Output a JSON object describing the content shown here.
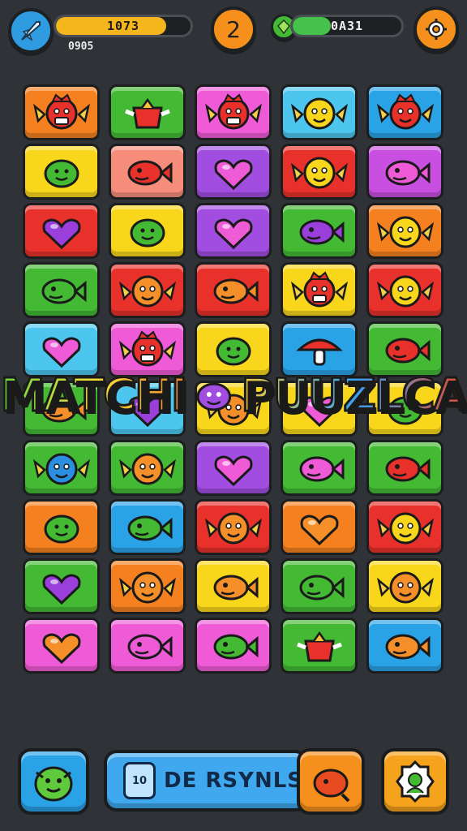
{
  "hud": {
    "xp_bar_value": "1073",
    "xp_progress": 0.82,
    "xp_subtext": "0905",
    "level_number": "2",
    "energy_bar_value": "0A31",
    "energy_progress": 0.35
  },
  "title": {
    "word1": "MATCHI",
    "word2": "PUUZLCA"
  },
  "board": {
    "rows": [
      [
        {
          "color": "orange",
          "icon": "red-dragon-icon"
        },
        {
          "color": "green",
          "icon": "red-pot-icon"
        },
        {
          "color": "pink",
          "icon": "red-dragon-icon"
        },
        {
          "color": "cyan",
          "icon": "yellow-bird-icon"
        },
        {
          "color": "blue",
          "icon": "red-crown-bird-icon"
        }
      ],
      [
        {
          "color": "yellow",
          "icon": "green-blob-icon"
        },
        {
          "color": "salmon",
          "icon": "red-fish-icon"
        },
        {
          "color": "purple",
          "icon": "pink-heart-icon"
        },
        {
          "color": "red",
          "icon": "yellow-bird-icon"
        },
        {
          "color": "violet",
          "icon": "pink-fish-icon"
        }
      ],
      [
        {
          "color": "red",
          "icon": "purple-heart-icon"
        },
        {
          "color": "yellow",
          "icon": "green-blob-icon"
        },
        {
          "color": "purple",
          "icon": "pink-heart-icon"
        },
        {
          "color": "green",
          "icon": "purple-fish-icon"
        },
        {
          "color": "orange",
          "icon": "yellow-bird-icon"
        }
      ],
      [
        {
          "color": "green",
          "icon": "green-fish-icon"
        },
        {
          "color": "red",
          "icon": "orange-bird-icon"
        },
        {
          "color": "red",
          "icon": "orange-fish-icon"
        },
        {
          "color": "yellow",
          "icon": "red-dragon-icon"
        },
        {
          "color": "red",
          "icon": "yellow-bird-icon"
        }
      ],
      [
        {
          "color": "cyan",
          "icon": "pink-heart-icon"
        },
        {
          "color": "pink",
          "icon": "red-dragon-icon"
        },
        {
          "color": "yellow",
          "icon": "green-blob-icon"
        },
        {
          "color": "blue",
          "icon": "red-mushroom-icon"
        },
        {
          "color": "green",
          "icon": "red-fish-icon"
        }
      ],
      [
        {
          "color": "green",
          "icon": "orange-fish-icon"
        },
        {
          "color": "cyan",
          "icon": "purple-heart-icon"
        },
        {
          "color": "yellow",
          "icon": "orange-bird-icon"
        },
        {
          "color": "yellow",
          "icon": "pink-heart-icon"
        },
        {
          "color": "yellow",
          "icon": "green-blob-icon"
        }
      ],
      [
        {
          "color": "green",
          "icon": "blue-bird-icon"
        },
        {
          "color": "green",
          "icon": "orange-bird-icon"
        },
        {
          "color": "purple",
          "icon": "pink-heart-icon"
        },
        {
          "color": "green",
          "icon": "pink-fish-icon"
        },
        {
          "color": "green",
          "icon": "red-fish-icon"
        }
      ],
      [
        {
          "color": "orange",
          "icon": "green-blob-icon"
        },
        {
          "color": "blue",
          "icon": "green-fish-icon"
        },
        {
          "color": "red",
          "icon": "orange-bird-icon"
        },
        {
          "color": "orange",
          "icon": "orange-heart-icon"
        },
        {
          "color": "red",
          "icon": "yellow-bird-icon"
        }
      ],
      [
        {
          "color": "green",
          "icon": "purple-heart-icon"
        },
        {
          "color": "orange",
          "icon": "orange-bird-icon"
        },
        {
          "color": "yellow",
          "icon": "orange-fish-icon"
        },
        {
          "color": "green",
          "icon": "green-fish-icon"
        },
        {
          "color": "yellow",
          "icon": "orange-bird-icon"
        }
      ],
      [
        {
          "color": "pink",
          "icon": "orange-heart-icon"
        },
        {
          "color": "pink",
          "icon": "pink-fish-icon"
        },
        {
          "color": "pink",
          "icon": "green-fish-icon"
        },
        {
          "color": "green",
          "icon": "red-pot-icon"
        },
        {
          "color": "blue",
          "icon": "orange-fish-icon"
        }
      ]
    ]
  },
  "bottom": {
    "booster_label": "DE RSYNLS",
    "booster_count": "10"
  },
  "colors": {
    "red": "#e8312b",
    "orange": "#f4801f",
    "yellow": "#f8d61c",
    "green": "#43b934",
    "blue": "#2aa2e6",
    "cyan": "#4cc6ef",
    "purple": "#a04de0",
    "pink": "#ef5bd6",
    "violet": "#c84fe0",
    "salmon": "#f58d7a"
  }
}
